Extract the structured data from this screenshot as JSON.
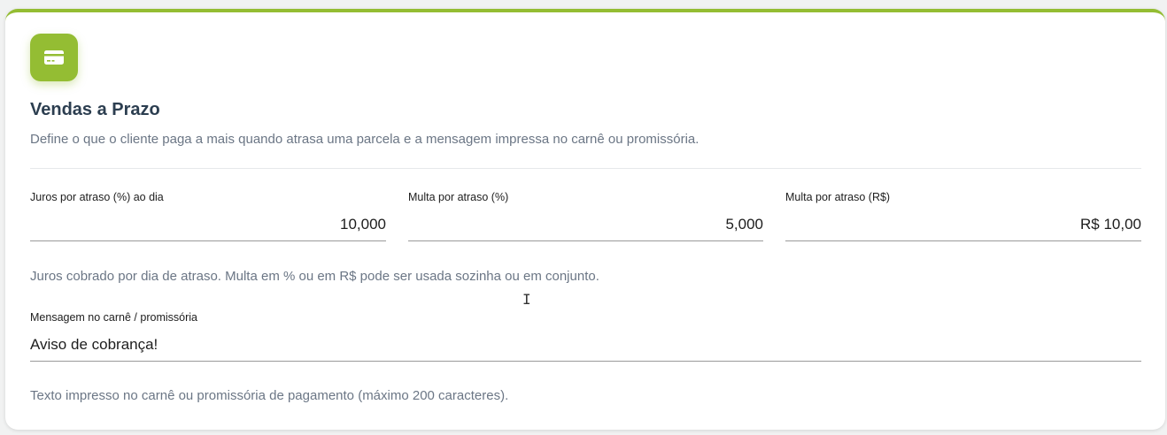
{
  "section": {
    "icon": "credit-card-icon",
    "title": "Vendas a Prazo",
    "description": "Define o que o cliente paga a mais quando atrasa uma parcela e a mensagem impressa no carnê ou promissória."
  },
  "fields": {
    "juros": {
      "label": "Juros por atraso (%) ao dia",
      "value": "10,000"
    },
    "multa_percent": {
      "label": "Multa por atraso (%)",
      "value": "5,000"
    },
    "multa_reais": {
      "label": "Multa por atraso (R$)",
      "value": "R$ 10,00"
    }
  },
  "fees_hint": "Juros cobrado por dia de atraso. Multa em % ou em R$ pode ser usada sozinha ou em conjunto.",
  "message": {
    "label": "Mensagem no carnê / promissória",
    "value": "Aviso de cobrança!",
    "hint": "Texto impresso no carnê ou promissória de pagamento (máximo 200 caracteres)."
  },
  "colors": {
    "accent": "#94bd33",
    "title": "#2c3e50",
    "muted": "#6b7685"
  }
}
